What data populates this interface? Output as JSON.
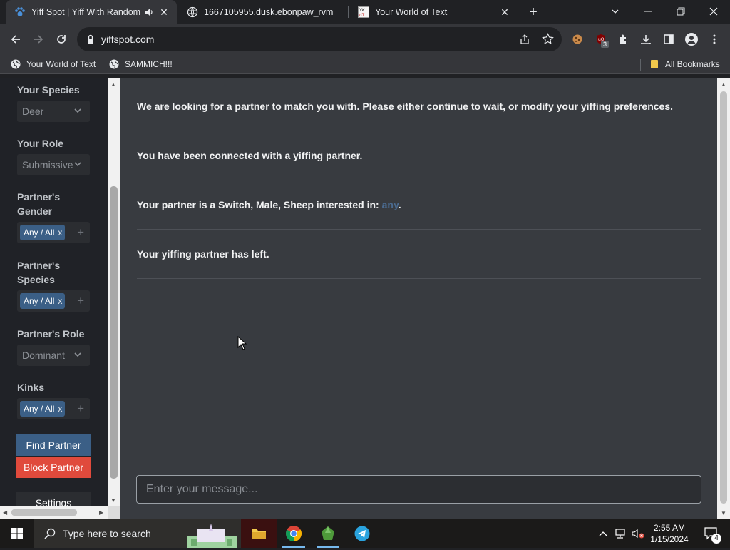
{
  "browser": {
    "tabs": [
      {
        "title": "Yiff Spot | Yiff With Random",
        "icon": "paw-icon",
        "active": true
      },
      {
        "title": "1667105955.dusk.ebonpaw_rvm",
        "icon": "globe-outline-icon",
        "active": false
      },
      {
        "title": "Your World of Text",
        "icon": "yw-text-icon",
        "active": false
      }
    ],
    "url": "yiffspot.com",
    "bookmarks": [
      {
        "label": "Your World of Text",
        "icon": "globe-icon"
      },
      {
        "label": "SAMMICH!!!",
        "icon": "globe-icon"
      }
    ],
    "all_bookmarks_label": "All Bookmarks",
    "extension_badge": "3"
  },
  "sidebar": {
    "your_species": {
      "label": "Your Species",
      "value": "Deer"
    },
    "your_role": {
      "label": "Your Role",
      "value": "Submissive"
    },
    "partner_gender": {
      "label_line1": "Partner's",
      "label_line2": "Gender",
      "tag": "Any / All",
      "tag_remove": "x",
      "add": "+"
    },
    "partner_species": {
      "label_line1": "Partner's",
      "label_line2": "Species",
      "tag": "Any / All",
      "tag_remove": "x",
      "add": "+"
    },
    "partner_role": {
      "label": "Partner's Role",
      "value": "Dominant"
    },
    "kinks": {
      "label": "Kinks",
      "tag": "Any / All",
      "tag_remove": "x",
      "add": "+"
    },
    "find_partner": "Find Partner",
    "block_partner": "Block Partner",
    "settings": "Settings",
    "colors": {
      "find": "#3b5f86",
      "block": "#e04a3c"
    }
  },
  "chat": {
    "messages": [
      {
        "text": "We are looking for a partner to match you with. Please either continue to wait, or modify your yiffing preferences."
      },
      {
        "text": "You have been connected with a yiffing partner."
      },
      {
        "prefix": "Your partner is a Switch, Male, Sheep interested in: ",
        "link": "any",
        "suffix": "."
      },
      {
        "text": "Your yiffing partner has left."
      }
    ],
    "input_placeholder": "Enter your message..."
  },
  "taskbar": {
    "search_placeholder": "Type here to search",
    "time": "2:55 AM",
    "date": "1/15/2024",
    "notification_count": "4"
  }
}
